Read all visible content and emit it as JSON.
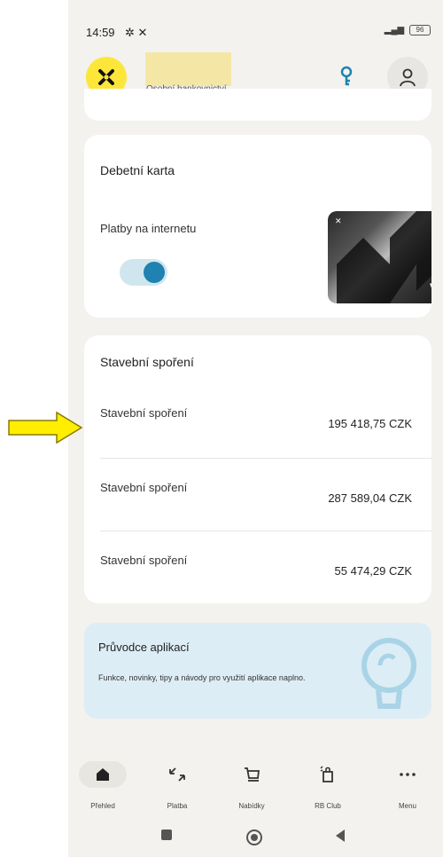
{
  "status": {
    "time": "14:59",
    "battery": "96"
  },
  "header": {
    "subtitle": "Osobní bankovnictví"
  },
  "debit_card": {
    "title": "Debetní karta",
    "payments_label": "Platby na internetu",
    "payments_enabled": true,
    "card_brand": "VI"
  },
  "building_savings": {
    "title": "Stavební spoření",
    "accounts": [
      {
        "name": "Stavební spoření",
        "amount": "195 418,75 CZK"
      },
      {
        "name": "Stavební spoření",
        "amount": "287 589,04 CZK"
      },
      {
        "name": "Stavební spoření",
        "amount": "55 474,29 CZK"
      }
    ]
  },
  "guide": {
    "title": "Průvodce aplikací",
    "description": "Funkce, novinky, tipy a návody pro využití aplikace naplno."
  },
  "nav": [
    {
      "label": "Přehled",
      "icon": "home-icon",
      "active": true
    },
    {
      "label": "Platba",
      "icon": "transfer-arrows-icon",
      "active": false
    },
    {
      "label": "Nabídky",
      "icon": "cart-icon",
      "active": false
    },
    {
      "label": "RB Club",
      "icon": "gift-bag-icon",
      "active": false
    },
    {
      "label": "Menu",
      "icon": "more-icon",
      "active": false
    }
  ],
  "colors": {
    "brand_yellow": "#fde63a",
    "toggle_blue": "#1f82b0",
    "guide_bg": "#dcedf5",
    "annotation_arrow": "#ffee00"
  }
}
